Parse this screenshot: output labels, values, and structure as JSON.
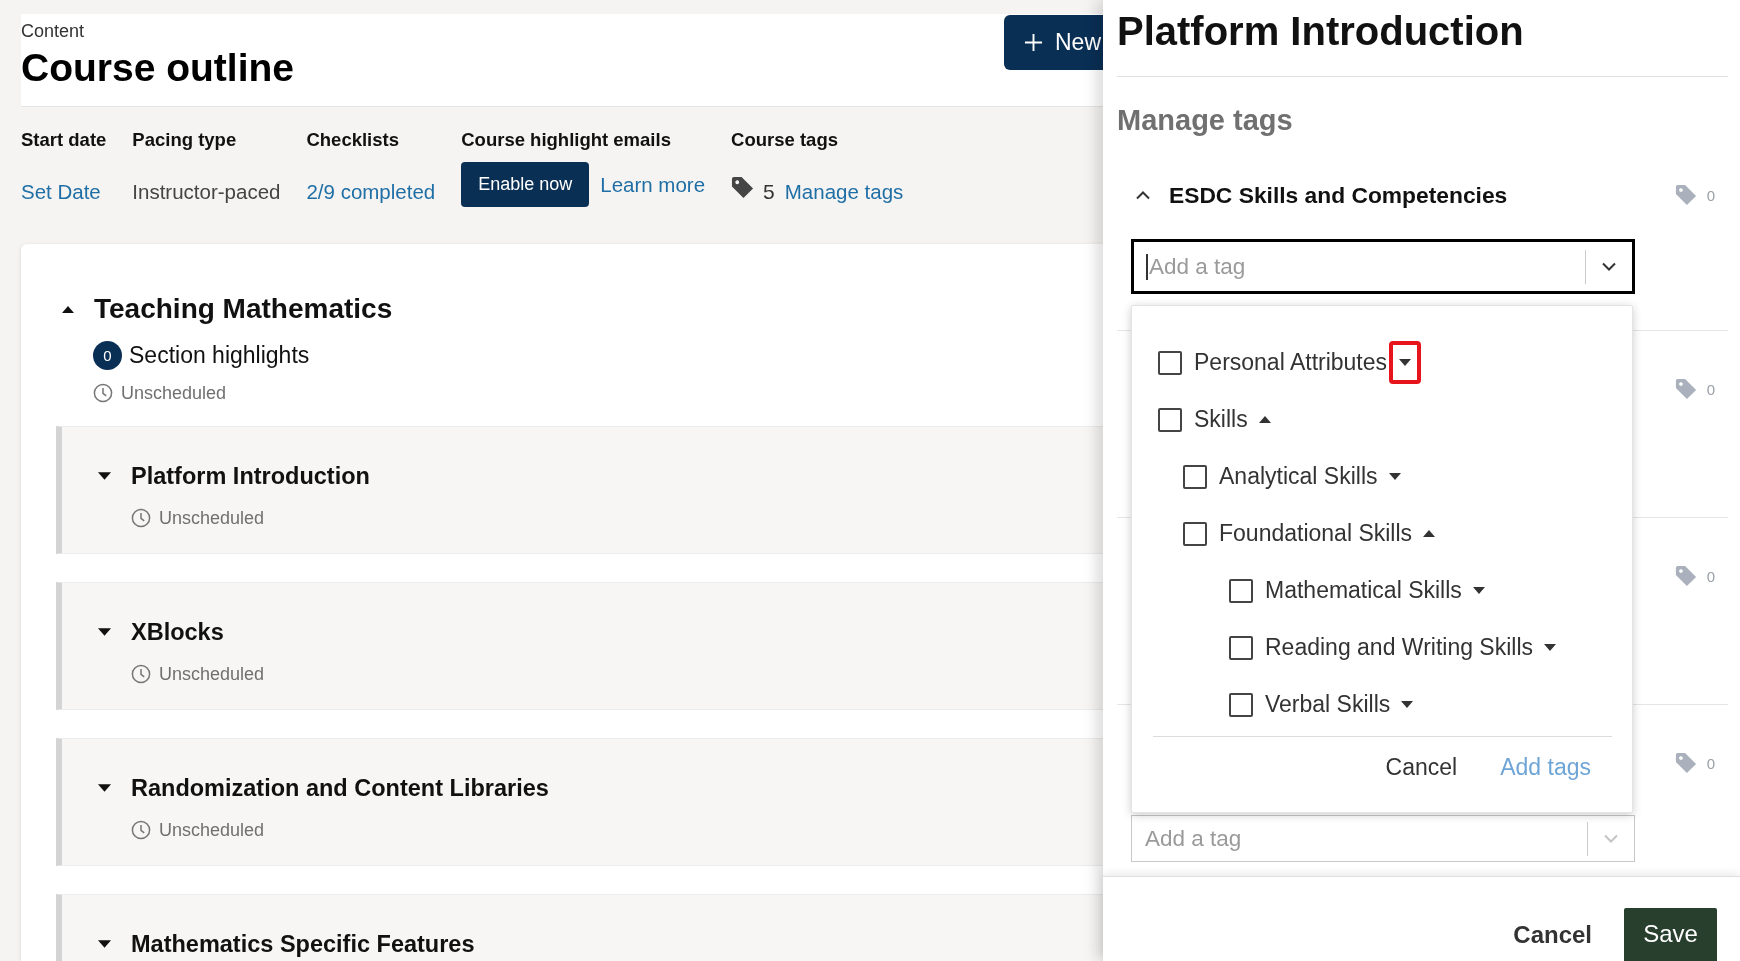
{
  "page": {
    "breadcrumb": "Content",
    "title": "Course outline",
    "new_button": "New"
  },
  "course_info": [
    {
      "kind": "link",
      "label": "Start date",
      "value": "Set Date"
    },
    {
      "kind": "text",
      "label": "Pacing type",
      "value": "Instructor-paced"
    },
    {
      "kind": "link",
      "label": "Checklists",
      "value": "2/9 completed"
    },
    {
      "kind": "actions",
      "label": "Course highlight emails",
      "button": "Enable now",
      "link": "Learn more"
    },
    {
      "kind": "tags",
      "label": "Course tags",
      "count": "5",
      "link": "Manage tags"
    }
  ],
  "section": {
    "title": "Teaching Mathematics",
    "expanded": true,
    "highlights_count": "0",
    "highlights_label": "Section highlights",
    "status": "Unscheduled",
    "subsections": [
      {
        "title": "Platform Introduction",
        "expanded": false,
        "status": "Unscheduled"
      },
      {
        "title": "XBlocks",
        "expanded": false,
        "status": "Unscheduled"
      },
      {
        "title": "Randomization and Content Libraries",
        "expanded": false,
        "status": "Unscheduled"
      },
      {
        "title": "Mathematics Specific Features",
        "expanded": false
      }
    ]
  },
  "panel": {
    "title": "Platform Introduction",
    "heading": "Manage tags",
    "taxonomies": [
      {
        "name": "ESDC Skills and Competencies",
        "expanded": true,
        "count": "0",
        "field": {
          "placeholder": "Add a tag",
          "focused": true
        }
      },
      {
        "count": "0"
      },
      {
        "count": "0"
      },
      {
        "count": "0",
        "field": {
          "placeholder": "Add a tag",
          "focused": false
        }
      }
    ],
    "cancel": "Cancel",
    "save": "Save"
  },
  "dropdown": {
    "options": [
      {
        "label": "Personal Attributes",
        "checked": false,
        "expanded": false,
        "highlighted": true
      },
      {
        "label": "Skills",
        "checked": false,
        "expanded": true,
        "highlighted": false,
        "children": [
          {
            "label": "Analytical Skills",
            "checked": false,
            "expanded": false,
            "highlighted": false
          },
          {
            "label": "Foundational Skills",
            "checked": false,
            "expanded": true,
            "highlighted": false,
            "children": [
              {
                "label": "Mathematical Skills",
                "checked": false,
                "expanded": false,
                "highlighted": false
              },
              {
                "label": "Reading and Writing Skills",
                "checked": false,
                "expanded": false,
                "highlighted": false
              },
              {
                "label": "Verbal Skills",
                "checked": false,
                "expanded": false,
                "highlighted": false
              }
            ]
          }
        ]
      }
    ],
    "cancel": "Cancel",
    "confirm": "Add tags"
  }
}
